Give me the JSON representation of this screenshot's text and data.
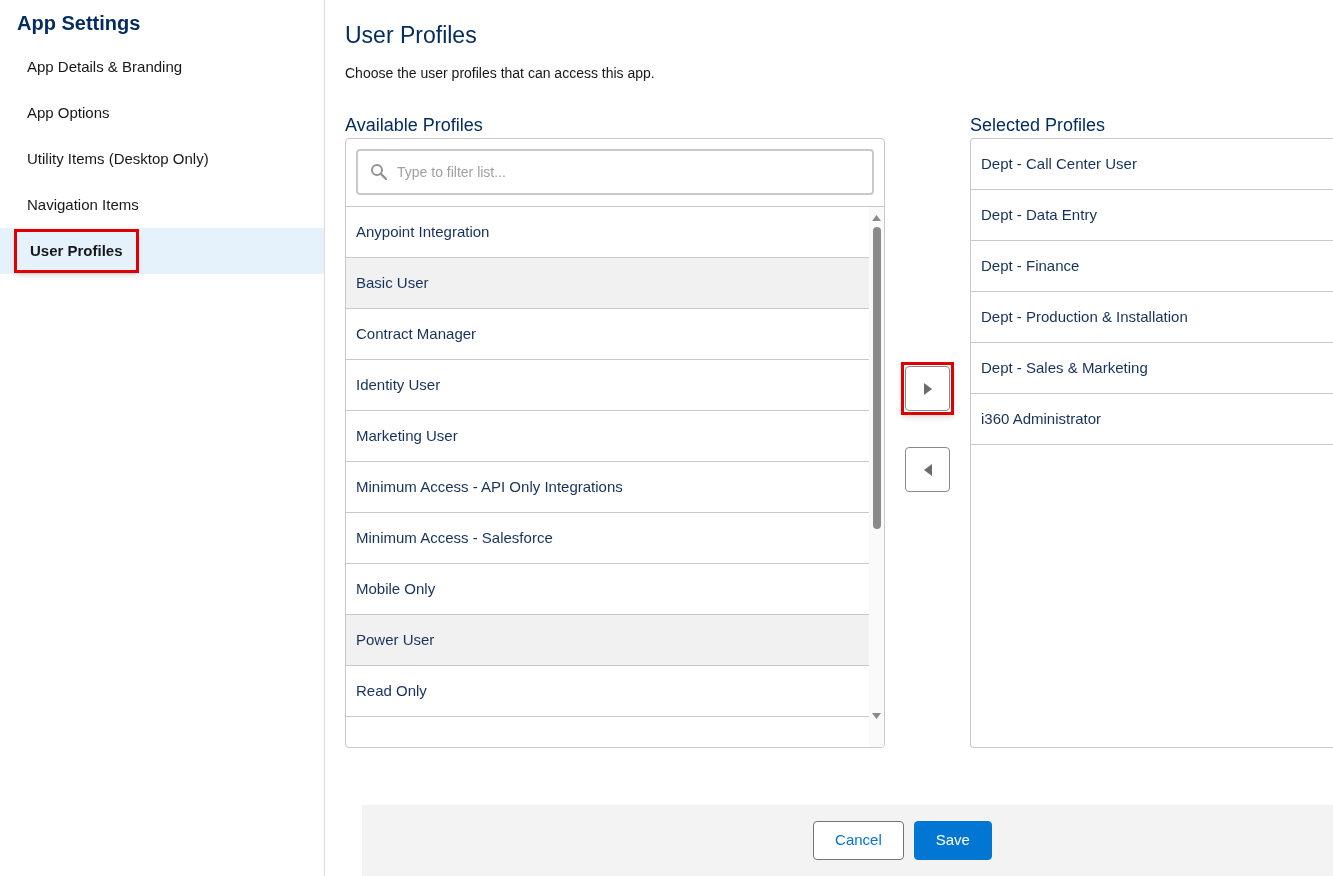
{
  "sidebar": {
    "title": "App Settings",
    "items": [
      {
        "label": "App Details & Branding",
        "selected": false,
        "highlighted": false
      },
      {
        "label": "App Options",
        "selected": false,
        "highlighted": false
      },
      {
        "label": "Utility Items (Desktop Only)",
        "selected": false,
        "highlighted": false
      },
      {
        "label": "Navigation Items",
        "selected": false,
        "highlighted": false
      },
      {
        "label": "User Profiles",
        "selected": true,
        "highlighted": true
      }
    ]
  },
  "main": {
    "title": "User Profiles",
    "description": "Choose the user profiles that can access this app.",
    "available": {
      "heading": "Available Profiles",
      "filter": {
        "placeholder": "Type to filter list..."
      },
      "items": [
        {
          "label": "Anypoint Integration",
          "selected": false
        },
        {
          "label": "Basic User",
          "selected": true
        },
        {
          "label": "Contract Manager",
          "selected": false
        },
        {
          "label": "Identity User",
          "selected": false
        },
        {
          "label": "Marketing User",
          "selected": false
        },
        {
          "label": "Minimum Access - API Only Integrations",
          "selected": false
        },
        {
          "label": "Minimum Access - Salesforce",
          "selected": false
        },
        {
          "label": "Mobile Only",
          "selected": false
        },
        {
          "label": "Power User",
          "selected": true
        },
        {
          "label": "Read Only",
          "selected": false
        }
      ]
    },
    "move_buttons": [
      {
        "kind": "right",
        "highlighted": true
      },
      {
        "kind": "left",
        "highlighted": false
      }
    ],
    "selected_list": {
      "heading": "Selected Profiles",
      "items": [
        {
          "label": "Dept - Call Center User"
        },
        {
          "label": "Dept - Data Entry"
        },
        {
          "label": "Dept - Finance"
        },
        {
          "label": "Dept - Production & Installation"
        },
        {
          "label": "Dept - Sales & Marketing"
        },
        {
          "label": "i360 Administrator"
        }
      ]
    }
  },
  "footer": {
    "buttons": [
      {
        "kind": "secondary",
        "label": "Cancel"
      },
      {
        "kind": "primary",
        "label": "Save"
      }
    ]
  }
}
